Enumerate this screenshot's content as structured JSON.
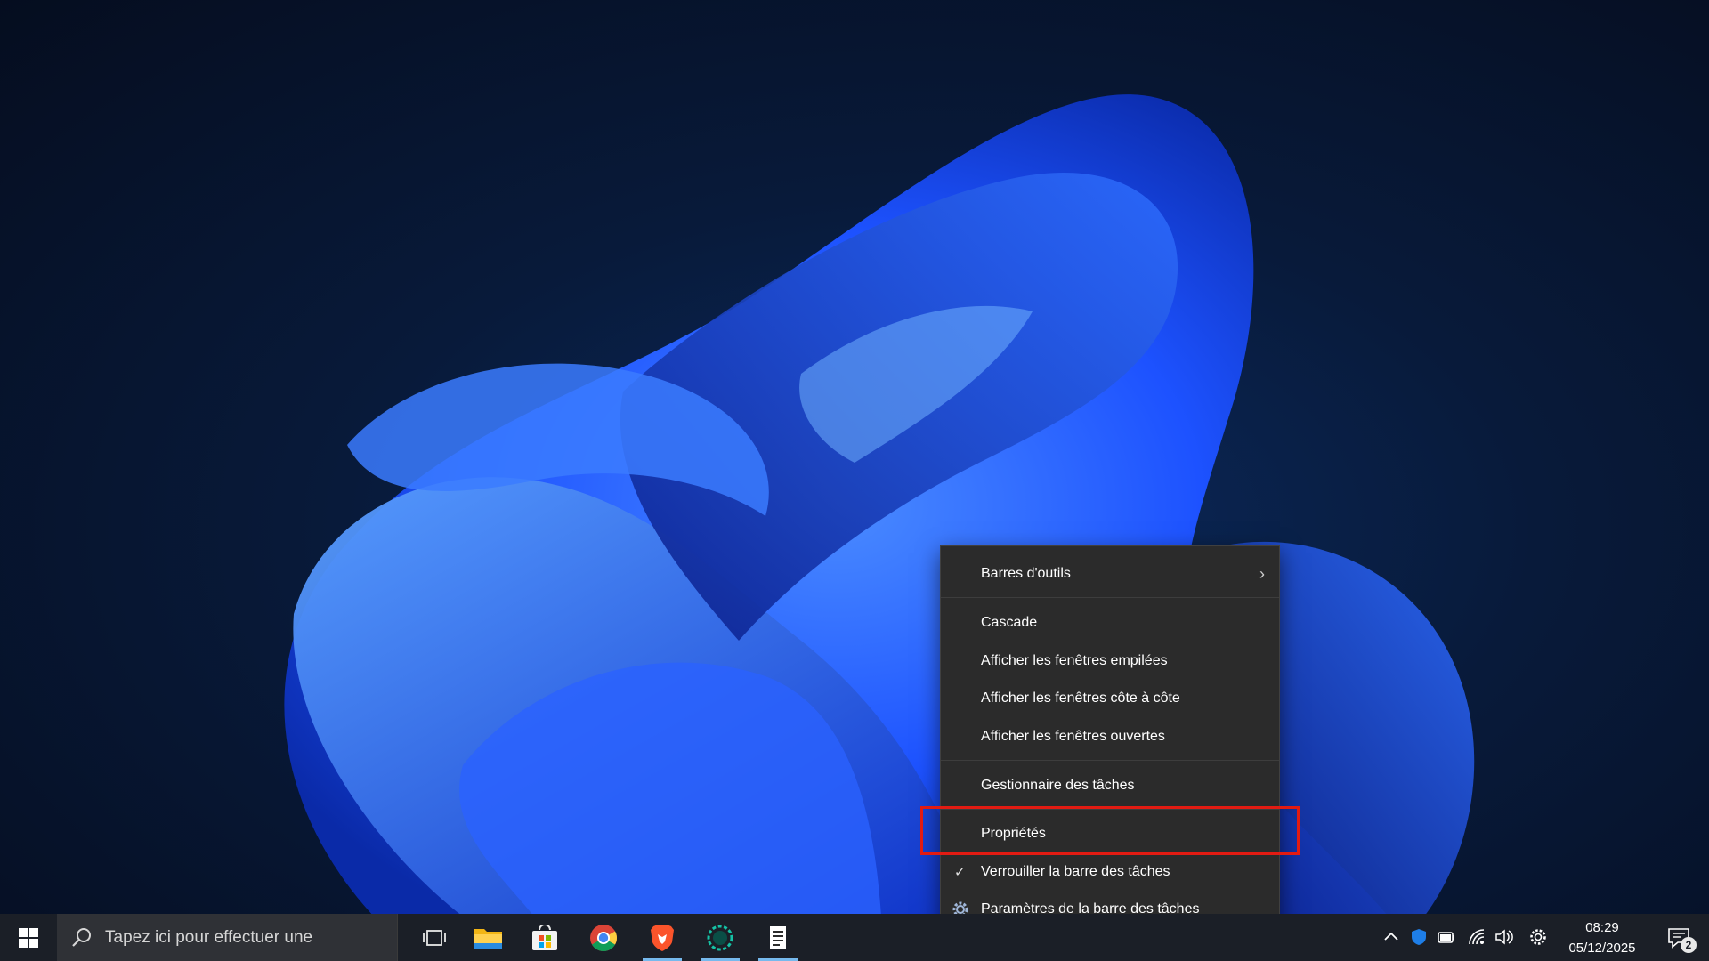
{
  "context_menu": {
    "items": [
      {
        "label": "Barres d'outils",
        "has_submenu": true
      },
      {
        "label": "Cascade"
      },
      {
        "label": "Afficher les fenêtres empilées"
      },
      {
        "label": "Afficher les fenêtres côte à côte"
      },
      {
        "label": "Afficher les fenêtres ouvertes"
      },
      {
        "label": "Gestionnaire des tâches"
      },
      {
        "label": "Propriétés",
        "highlighted": true
      },
      {
        "label": "Verrouiller la barre des tâches",
        "checked": true
      },
      {
        "label": "Paramètres de la barre des tâches",
        "icon": "gear-icon"
      }
    ],
    "submenu_glyph": "›",
    "check_glyph": "✓"
  },
  "taskbar": {
    "search_placeholder": "Tapez ici pour effectuer une",
    "apps": [
      "task-view-icon",
      "file-explorer-icon",
      "microsoft-store-icon",
      "chrome-icon",
      "brave-icon",
      "circle-app-icon",
      "notepad-app-icon"
    ],
    "tray_icons": [
      "chevron-up-icon",
      "shield-icon",
      "battery-icon",
      "wifi-icon",
      "volume-icon",
      "gear-icon"
    ],
    "clock": {
      "time": "08:29",
      "date": "05/12/2025"
    },
    "notification_count": "2"
  },
  "colors": {
    "menu_bg": "#2b2b2b",
    "highlight_border": "#e21b12",
    "taskbar_bg": "#1b1f27",
    "active_indicator": "#76b9ed"
  }
}
